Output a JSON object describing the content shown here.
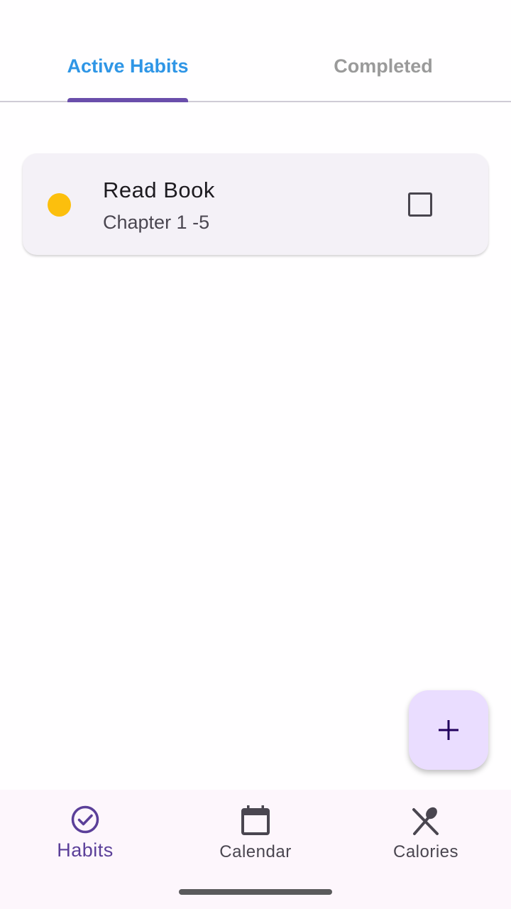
{
  "tabs": {
    "active_label": "Active Habits",
    "completed_label": "Completed",
    "selected": "Active Habits"
  },
  "habits": [
    {
      "title": "Read Book",
      "subtitle": "Chapter 1 -5",
      "color": "#fcbf0d",
      "checked": false
    }
  ],
  "fab": {
    "icon": "plus-icon"
  },
  "bottom_nav": {
    "items": [
      {
        "label": "Habits",
        "icon": "check-circle-icon",
        "selected": true
      },
      {
        "label": "Calendar",
        "icon": "calendar-icon",
        "selected": false
      },
      {
        "label": "Calories",
        "icon": "utensils-icon",
        "selected": false
      }
    ]
  },
  "colors": {
    "accent": "#6a4eab",
    "tab_active_text": "#2f96e6",
    "fab_background": "#eaddff",
    "nav_background": "#fdf6fc"
  }
}
